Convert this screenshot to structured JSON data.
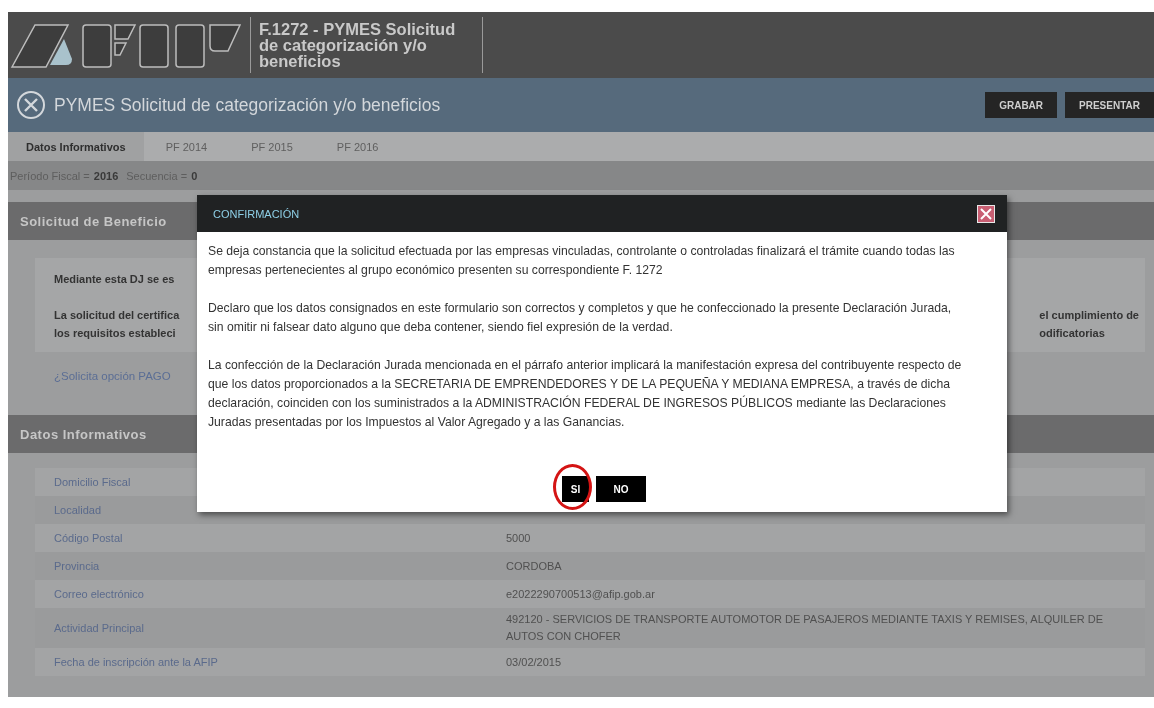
{
  "header": {
    "title": "F.1272 - PYMES Solicitud de categorización y/o beneficios"
  },
  "title_bar": {
    "title": "PYMES Solicitud de categorización y/o beneficios",
    "buttons": [
      "GRABAR",
      "PRESENTAR"
    ]
  },
  "tabs": [
    {
      "label": "Datos Informativos",
      "selected": true
    },
    {
      "label": "PF 2014",
      "selected": false
    },
    {
      "label": "PF 2015",
      "selected": false
    },
    {
      "label": "PF 2016",
      "selected": false
    }
  ],
  "fiscal_line": {
    "period_label": "Período Fiscal =",
    "period": "2016",
    "sequence_label": "Secuencia =",
    "sequence": "0"
  },
  "benefit_section": {
    "title": "Solicitud de Beneficio",
    "notice": [
      {
        "left": [
          "Mediante esta DJ se es"
        ]
      },
      {
        "left": [
          "La solicitud del certifica",
          "los requisitos estableci"
        ],
        "right": [
          "el cumplimiento de",
          "odificatorias"
        ]
      }
    ],
    "link": "¿Solicita opción PAGO"
  },
  "data_section": {
    "title": "Datos Informativos",
    "rows": [
      {
        "label": "Domicilio Fiscal"
      },
      {
        "label": "Localidad"
      },
      {
        "label": "Código Postal",
        "value": "5000"
      },
      {
        "label": "Provincia",
        "value": "CORDOBA"
      },
      {
        "label": "Correo electrónico",
        "value": "e2022290700513@afip.gob.ar"
      },
      {
        "label": "Actividad Principal",
        "value": "492120 - SERVICIOS DE TRANSPORTE AUTOMOTOR DE PASAJEROS MEDIANTE TAXIS Y REMISES, ALQUILER DE AUTOS CON CHOFER"
      },
      {
        "label": "Fecha de inscripción ante la AFIP",
        "value": "03/02/2015"
      }
    ]
  },
  "dialog": {
    "title": "CONFIRMACIÓN",
    "paragraphs": [
      "Se deja constancia que la solicitud efectuada por las empresas vinculadas, controlante o controladas finalizará el trámite cuando todas las empresas pertenecientes al grupo económico presenten su correspondiente F. 1272",
      "Declaro que los datos consignados en este formulario son correctos y completos y que he confeccionado la presente Declaración Jurada, sin omitir ni falsear dato alguno que deba contener, siendo fiel expresión de la verdad.",
      "La confección de la Declaración Jurada mencionada en el párrafo anterior implicará la manifestación expresa del contribuyente respecto de que los datos proporcionados a la SECRETARIA DE EMPRENDEDORES Y DE LA PEQUEÑA Y MEDIANA EMPRESA, a través de dicha declaración, coinciden con los suministrados a la ADMINISTRACIÓN FEDERAL DE INGRESOS PÚBLICOS mediante las Declaraciones Juradas presentadas por los Impuestos al Valor Agregado y a las Ganancias."
    ],
    "buttons": [
      {
        "label": "SI",
        "highlighted": true
      },
      {
        "label": "NO",
        "highlighted": false
      }
    ]
  }
}
